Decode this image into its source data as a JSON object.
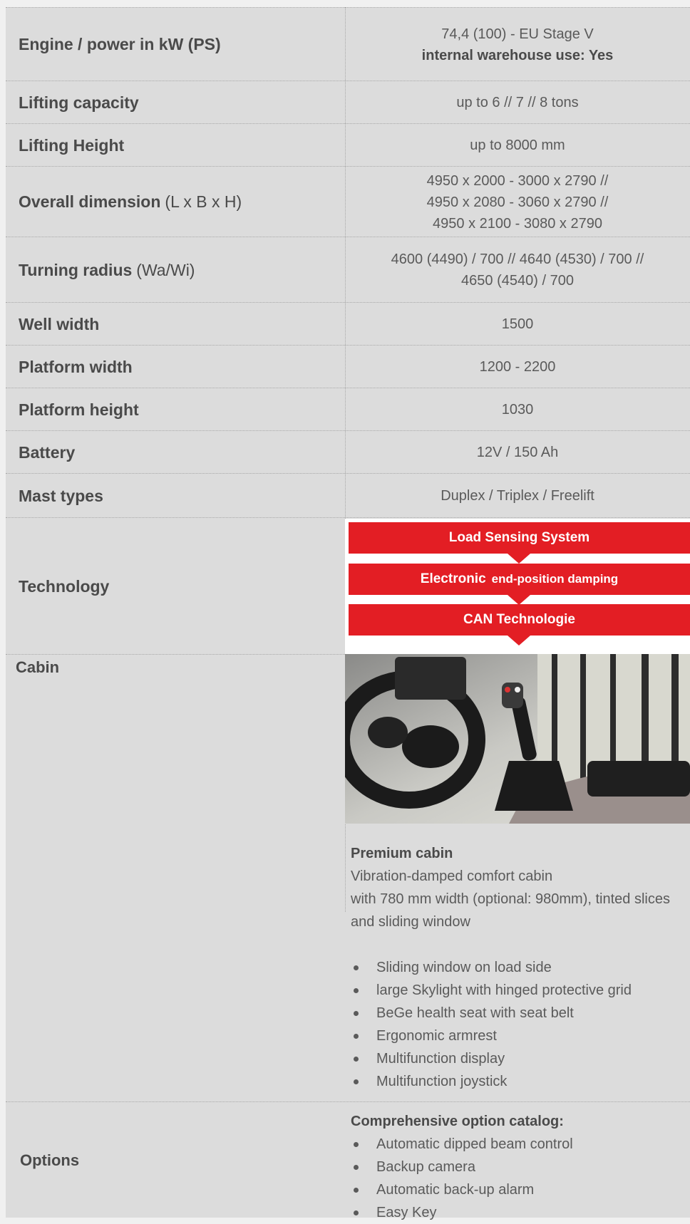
{
  "rows": {
    "engine": {
      "label": "Engine / power in kW (PS)",
      "value_line1": "74,4 (100) - EU Stage V",
      "value_line2": "internal warehouse use: Yes"
    },
    "lifting_capacity": {
      "label": "Lifting capacity",
      "value": "up to 6 // 7 // 8 tons"
    },
    "lifting_height": {
      "label": "Lifting Height",
      "value": "up to 8000 mm"
    },
    "overall_dimension": {
      "label": "Overall dimension",
      "label_suffix": "(L x B x H)",
      "value_lines": [
        "4950 x 2000 - 3000 x 2790 //",
        "4950 x 2080 - 3060 x 2790 //",
        "4950 x 2100 - 3080 x 2790"
      ]
    },
    "turning_radius": {
      "label": "Turning radius",
      "label_suffix": "(Wa/Wi)",
      "value_lines": [
        "4600 (4490) / 700 // 4640 (4530) / 700 //",
        "4650 (4540) / 700"
      ]
    },
    "well_width": {
      "label": "Well width",
      "value": "1500"
    },
    "platform_width": {
      "label": "Platform width",
      "value": "1200 - 2200"
    },
    "platform_height": {
      "label": "Platform height",
      "value": "1030"
    },
    "battery": {
      "label": "Battery",
      "value": "12V / 150 Ah"
    },
    "mast_types": {
      "label": "Mast types",
      "value": "Duplex / Triplex / Freelift"
    },
    "technology": {
      "label": "Technology",
      "bars": [
        "Load Sensing System",
        "Electronic",
        "end-position damping",
        "CAN Technologie"
      ]
    },
    "cabin": {
      "label": "Cabin",
      "heading": "Premium cabin",
      "description_lines": [
        "Vibration-damped comfort cabin",
        "with 780 mm width (optional: 980mm), tinted slices",
        "and sliding window"
      ],
      "bullets": [
        "Sliding window on load side",
        "large Skylight with hinged protective grid",
        "BeGe health seat with seat belt",
        "Ergonomic armrest",
        "Multifunction display",
        "Multifunction joystick"
      ]
    },
    "options": {
      "label": "Options",
      "heading": "Comprehensive option catalog:",
      "bullets": [
        "Automatic dipped beam control",
        "Backup camera",
        "Automatic back-up alarm",
        "Easy Key"
      ]
    }
  },
  "colors": {
    "accent_red": "#e31e24",
    "panel_gray": "#dcdcdc"
  }
}
